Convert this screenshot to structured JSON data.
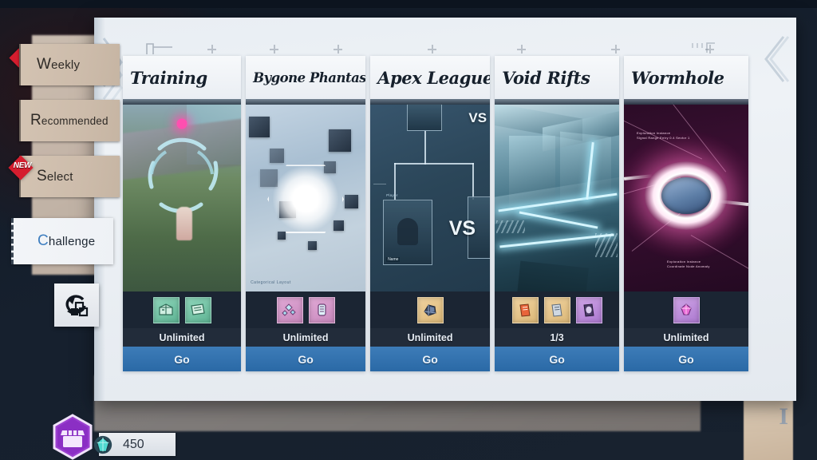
{
  "nav": {
    "items": [
      {
        "id": "weekly",
        "label": "Weekly",
        "cap": "W",
        "rest": "eekly",
        "active": false,
        "badge": ""
      },
      {
        "id": "recommended",
        "label": "Recommended",
        "cap": "R",
        "rest": "ecommended",
        "active": false,
        "badge": ""
      },
      {
        "id": "select",
        "label": "Select",
        "cap": "S",
        "rest": "elect",
        "active": false,
        "badge": "NEW"
      },
      {
        "id": "challenge",
        "label": "Challenge",
        "cap": "C",
        "rest": "hallenge",
        "active": true,
        "badge": ""
      }
    ]
  },
  "history_button": {
    "icon": "history-icon"
  },
  "cards": [
    {
      "id": "training",
      "title": "Training",
      "title_size": "large",
      "status": "Unlimited",
      "go_label": "Go",
      "art": "training-artwork",
      "rewards": [
        {
          "icon": "exp-crate-icon",
          "tone": "green",
          "glyph": "▣"
        },
        {
          "icon": "exp-note-icon",
          "tone": "green",
          "glyph": "▤"
        }
      ]
    },
    {
      "id": "bygone-phantasm",
      "title": "Bygone Phantasm",
      "title_size": "small",
      "status": "Unlimited",
      "go_label": "Go",
      "art": "bygone-phantasm-artwork",
      "rewards": [
        {
          "icon": "crystal-cluster-icon",
          "tone": "pink",
          "glyph": "❈"
        },
        {
          "icon": "energy-can-icon",
          "tone": "pink",
          "glyph": "▮"
        }
      ]
    },
    {
      "id": "apex-league",
      "title": "Apex League",
      "title_size": "large",
      "status": "Unlimited",
      "go_label": "Go",
      "art": "apex-league-artwork",
      "rewards": [
        {
          "icon": "apex-trophy-icon",
          "tone": "gold",
          "glyph": "❖"
        }
      ]
    },
    {
      "id": "void-rifts",
      "title": "Void Rifts",
      "title_size": "large",
      "status": "1/3",
      "go_label": "Go",
      "art": "void-rifts-artwork",
      "rewards": [
        {
          "icon": "red-matrix-chip-icon",
          "tone": "gold",
          "glyph": "☰"
        },
        {
          "icon": "silver-matrix-chip-icon",
          "tone": "gold",
          "glyph": "☷"
        },
        {
          "icon": "purple-matrix-chip-icon",
          "tone": "purple",
          "glyph": "■"
        }
      ]
    },
    {
      "id": "wormhole",
      "title": "Wormhole",
      "title_size": "large",
      "status": "Unlimited",
      "go_label": "Go",
      "art": "wormhole-artwork",
      "rewards": [
        {
          "icon": "purple-gem-icon",
          "tone": "purple",
          "glyph": "♦"
        }
      ]
    }
  ],
  "bottom": {
    "shop_icon": "shop-icon",
    "currency_icon": "dark-crystal-icon",
    "currency_amount": "450"
  },
  "art_text": {
    "apex_vs": "VS",
    "apex_player_tag": "Player",
    "apex_name_tag": "Name",
    "bygone_caption": "Categorical Layout",
    "wormhole_caption_top": "Exploration Instance\nSignal Range Entry 0.4 Sector 1",
    "wormhole_caption_bottom": "Exploration Instance\nCoordinate Node Anomaly"
  },
  "colors": {
    "accent_blue": "#2a69a6",
    "badge_red": "#d51d2e",
    "panel_bg": "#e9eef3",
    "card_foot": "#1b2533"
  }
}
